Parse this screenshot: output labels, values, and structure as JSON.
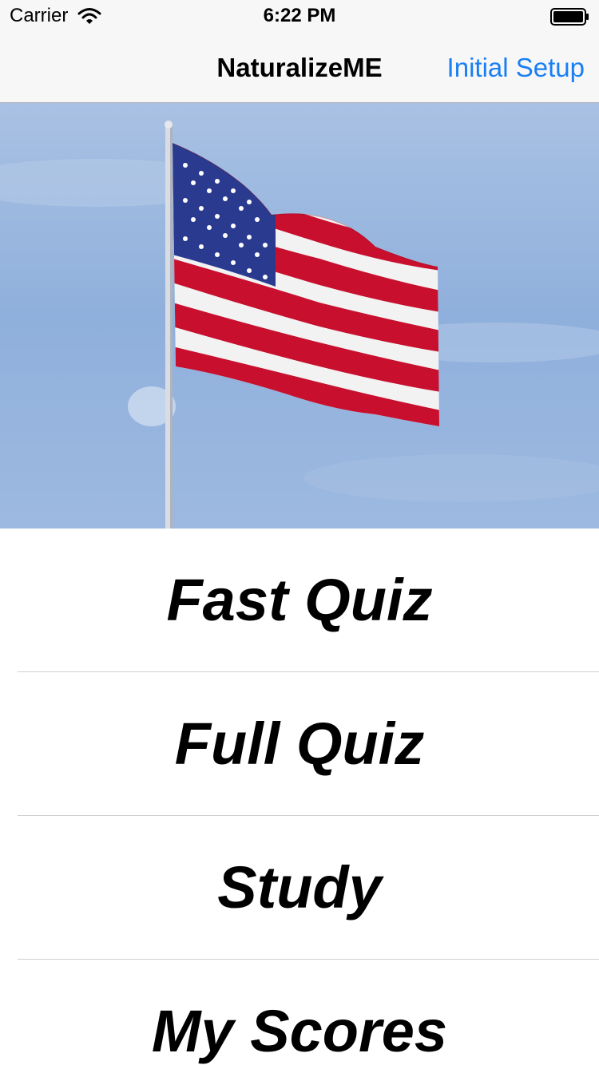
{
  "status_bar": {
    "carrier": "Carrier",
    "time": "6:22 PM"
  },
  "nav": {
    "title": "NaturalizeME",
    "right_button": "Initial Setup"
  },
  "colors": {
    "accent": "#1a7ff2",
    "sky": "#8fb0dc",
    "flag_red": "#c8102e",
    "flag_blue": "#2a3b8f"
  },
  "hero": {
    "image": "american-flag-on-pole"
  },
  "menu": {
    "items": [
      {
        "label": "Fast Quiz"
      },
      {
        "label": "Full Quiz"
      },
      {
        "label": "Study"
      },
      {
        "label": "My Scores"
      }
    ]
  }
}
